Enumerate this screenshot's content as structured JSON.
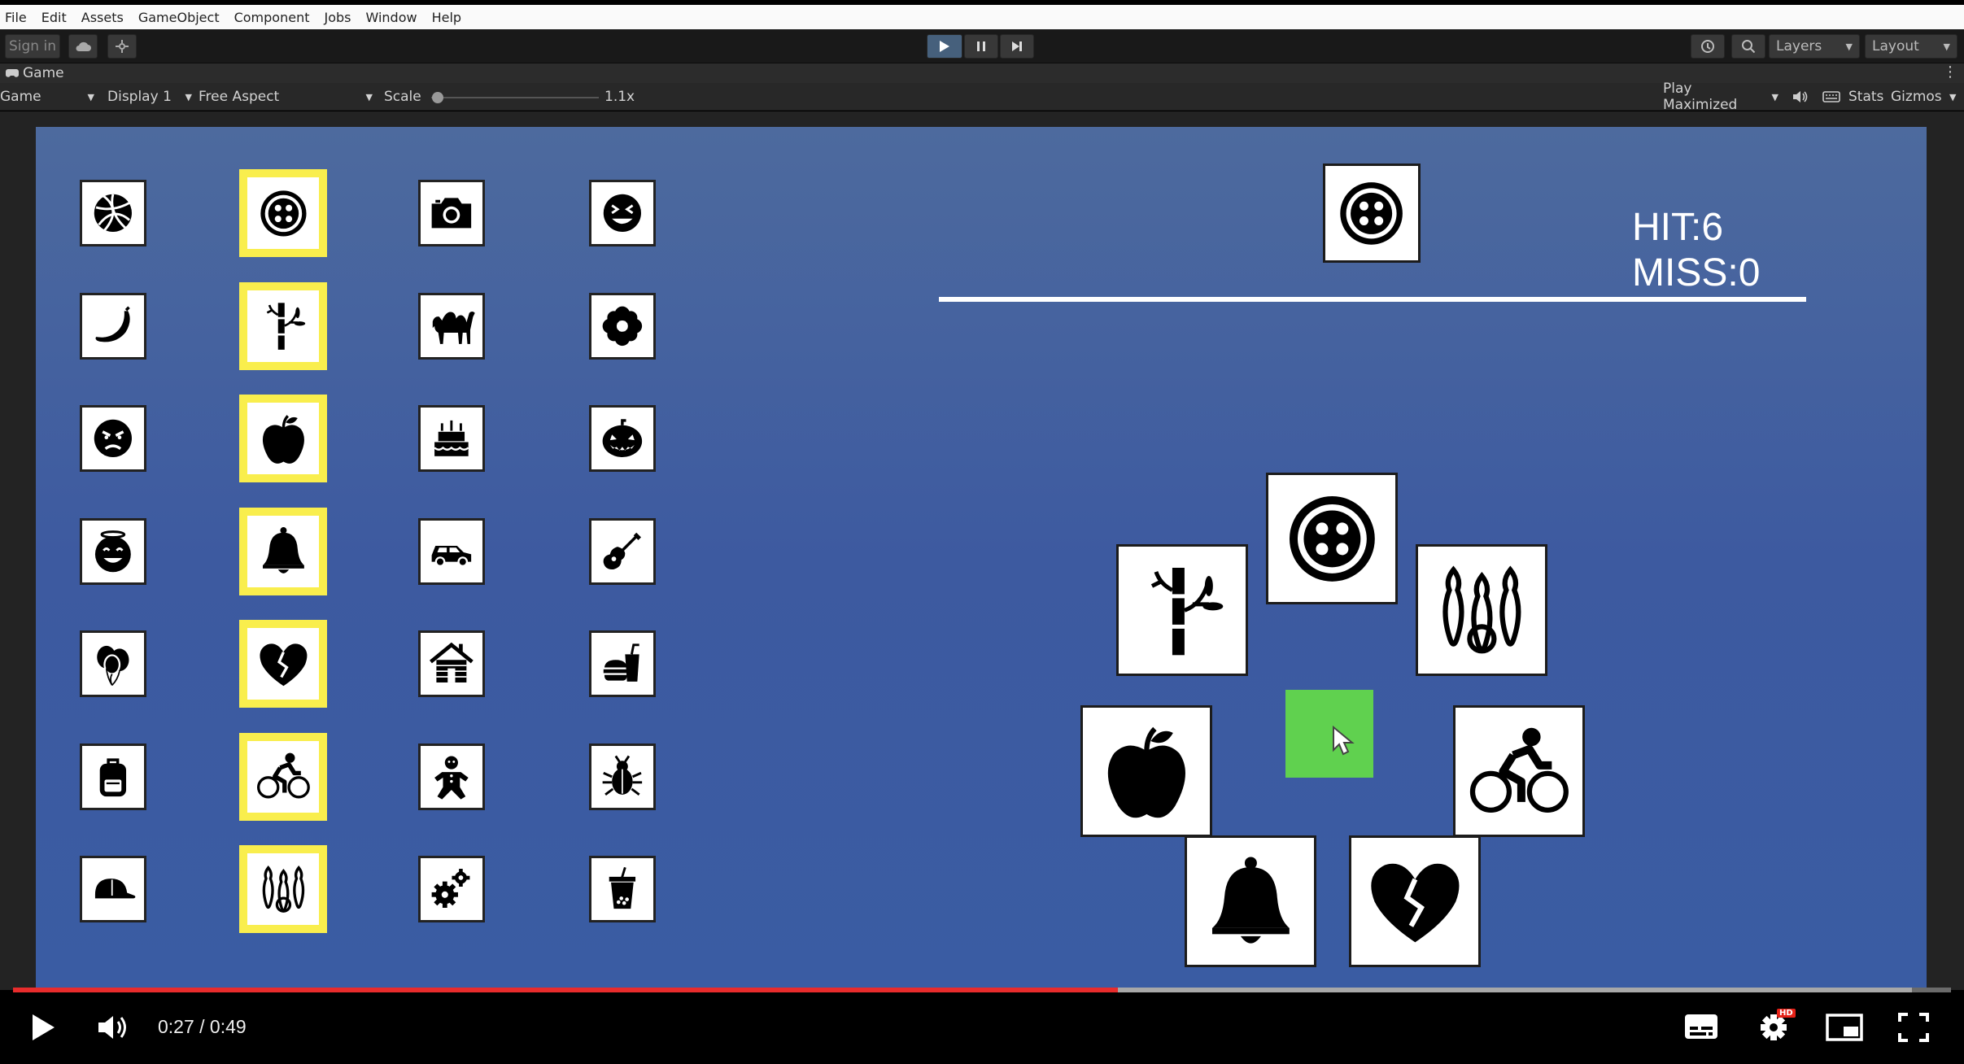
{
  "menu": [
    "File",
    "Edit",
    "Assets",
    "GameObject",
    "Component",
    "Jobs",
    "Window",
    "Help"
  ],
  "toolbar": {
    "sign_in": "Sign in",
    "layers": "Layers",
    "layout": "Layout"
  },
  "game_tab": {
    "title": "Game"
  },
  "game_toolbar": {
    "view": "Game",
    "display": "Display 1",
    "aspect": "Free Aspect",
    "scale_label": "Scale",
    "scale_value": "1.1x",
    "play_mode": "Play Maximized",
    "stats": "Stats",
    "gizmos": "Gizmos"
  },
  "hud": {
    "hit": "HIT:6",
    "miss": "MISS:0"
  },
  "grid": {
    "columns": [
      {
        "selected": false,
        "icons": [
          "basketball-icon",
          "banana-icon",
          "angry-face-icon",
          "angel-face-icon",
          "balloons-icon",
          "backpack-icon",
          "cap-icon"
        ]
      },
      {
        "selected": true,
        "icons": [
          "button-icon",
          "bamboo-icon",
          "apple-icon",
          "bell-icon",
          "broken-heart-icon",
          "cyclist-icon",
          "bowling-icon"
        ]
      },
      {
        "selected": false,
        "icons": [
          "camera-icon",
          "camel-icon",
          "cake-icon",
          "car-icon",
          "cabin-icon",
          "gingerbread-icon",
          "gears-icon"
        ]
      },
      {
        "selected": false,
        "icons": [
          "laughing-face-icon",
          "flower-icon",
          "pumpkin-icon",
          "guitar-icon",
          "fast-food-icon",
          "bug-icon",
          "bubble-tea-icon"
        ]
      }
    ]
  },
  "target_icon": "button-icon",
  "ring_icons": [
    "button-icon",
    "bamboo-icon",
    "bowling-icon",
    "apple-icon",
    "cyclist-icon",
    "bell-icon",
    "broken-heart-icon"
  ],
  "player": {
    "time": "0:27 / 0:49",
    "played_fraction": 0.57,
    "buffered_fraction": 0.98
  },
  "colors": {
    "selected_border": "#f9ee4d",
    "green_cursor": "#60d14f",
    "progress": "#e82c2c"
  }
}
